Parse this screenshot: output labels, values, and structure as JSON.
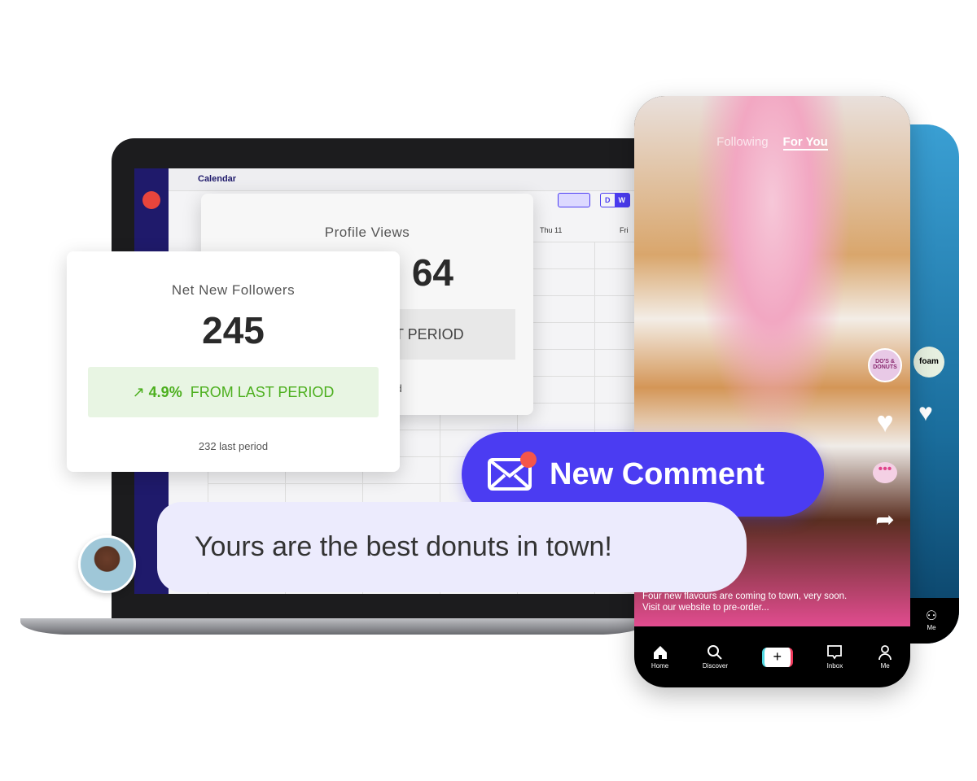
{
  "calendar": {
    "title": "Calendar",
    "days": [
      "Thu  11",
      "Fri"
    ],
    "view_modes": [
      "D",
      "W"
    ]
  },
  "profile_views": {
    "title": "Profile Views",
    "value": "64",
    "change": "T PERIOD",
    "last": "riod"
  },
  "net_new_followers": {
    "title": "Net New Followers",
    "value": "245",
    "change_pct": "4.9%",
    "change_label": "FROM LAST PERIOD",
    "last": "232 last period"
  },
  "phone": {
    "tabs": [
      "Following",
      "For You"
    ],
    "active_tab": "For You",
    "caption": "Four new flavours are coming to town, very soon. Visit our website to pre-order...",
    "profile": "DO'S & DONUTS",
    "nav": [
      "Home",
      "Discover",
      "Inbox",
      "Me"
    ],
    "back_profile": "foam",
    "back_nav": "Me"
  },
  "notification": {
    "label": "New Comment",
    "color": "#4b3cf2"
  },
  "comment": {
    "text": "Yours are the best donuts in town!"
  }
}
